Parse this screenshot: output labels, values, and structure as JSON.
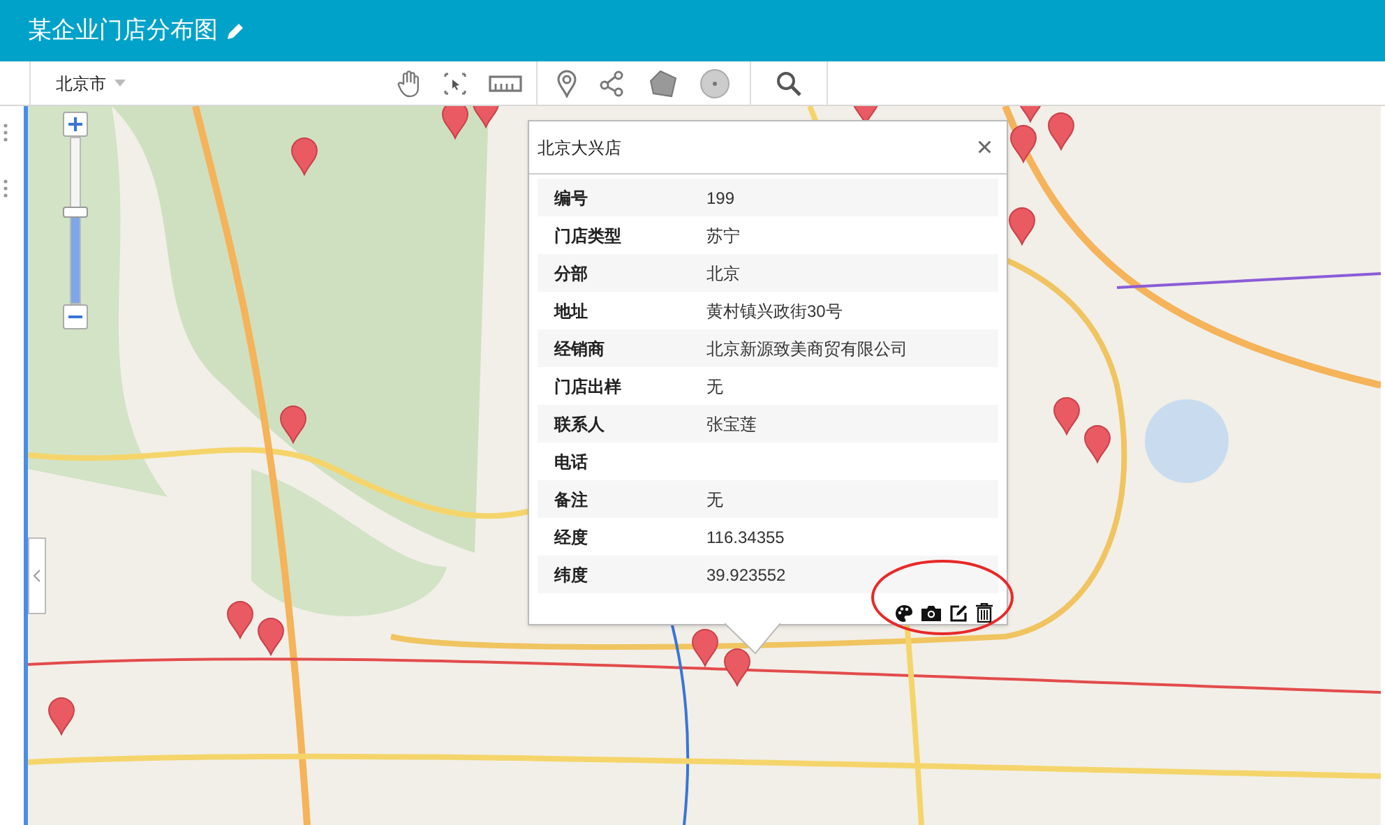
{
  "header": {
    "title": "某企业门店分布图"
  },
  "toolbar": {
    "city": "北京市"
  },
  "zoom_slider": {
    "level": 0.55
  },
  "popup": {
    "title": "北京大兴店",
    "close": "×",
    "rows": [
      {
        "label": "编号",
        "value": "199"
      },
      {
        "label": "门店类型",
        "value": "苏宁"
      },
      {
        "label": "分部",
        "value": "北京"
      },
      {
        "label": "地址",
        "value": "黄村镇兴政街30号"
      },
      {
        "label": "经销商",
        "value": "北京新源致美商贸有限公司"
      },
      {
        "label": "门店出样",
        "value": "无"
      },
      {
        "label": "联系人",
        "value": "张宝莲"
      },
      {
        "label": "电话"
      },
      {
        "label": "备注",
        "value": "无"
      },
      {
        "label": "经度",
        "value": "116.34355"
      },
      {
        "label": "纬度",
        "value": "39.923552"
      }
    ]
  }
}
